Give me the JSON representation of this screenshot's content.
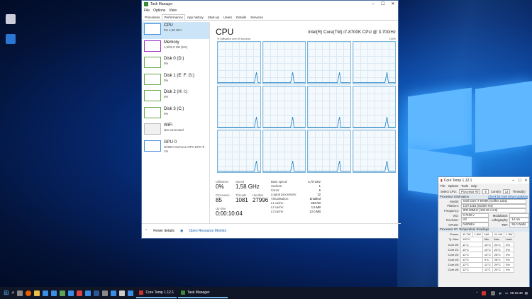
{
  "taskmanager": {
    "title": "Task Manager",
    "menu": [
      "File",
      "Options",
      "View"
    ],
    "tabs": [
      "Processes",
      "Performance",
      "App history",
      "Start-up",
      "Users",
      "Details",
      "Services"
    ],
    "resources": [
      {
        "name": "CPU",
        "sub": "0% 1,58 GHz",
        "color": "#4a90d9"
      },
      {
        "name": "Memory",
        "sub": "1,5/32,0 GB (5%)",
        "color": "#9b30c8"
      },
      {
        "name": "Disk 0 (D:)",
        "sub": "0%",
        "color": "#6aa84f"
      },
      {
        "name": "Disk 1 (E: F: G:)",
        "sub": "0%",
        "color": "#6aa84f"
      },
      {
        "name": "Disk 2 (H: I:)",
        "sub": "0%",
        "color": "#6aa84f"
      },
      {
        "name": "Disk 3 (C:)",
        "sub": "0%",
        "color": "#6aa84f"
      },
      {
        "name": "WiFi",
        "sub": "Not connected",
        "color": "#bbbbbb"
      },
      {
        "name": "GPU 0",
        "sub": "NVIDIA GeForce GTX 1070 Ti",
        "sub2": "1%",
        "color": "#4a90d9"
      }
    ],
    "cpu_title": "CPU",
    "cpu_model": "Intel(R) Core(TM) i7-8700K CPU @ 3.70GHz",
    "util_label": "% Utilisation over 60 seconds",
    "pct_max": "100%",
    "stats": {
      "utilisation_label": "Utilisation",
      "utilisation": "0%",
      "speed_label": "Speed",
      "speed": "1,58 GHz",
      "processes_label": "Processes",
      "processes": "85",
      "threads_label": "Threads",
      "threads": "1081",
      "handles_label": "Handles",
      "handles": "27996",
      "uptime_label": "Up time",
      "uptime": "0:00:10:04"
    },
    "specs": [
      {
        "k": "Base speed:",
        "v": "3,70 GHz"
      },
      {
        "k": "Sockets:",
        "v": "1"
      },
      {
        "k": "Cores:",
        "v": "6"
      },
      {
        "k": "Logical processors:",
        "v": "12"
      },
      {
        "k": "Virtualisation:",
        "v": "Enabled"
      },
      {
        "k": "L1 cache:",
        "v": "384 KB"
      },
      {
        "k": "L2 cache:",
        "v": "1,5 MB"
      },
      {
        "k": "L3 cache:",
        "v": "12,0 MB"
      }
    ],
    "fewer_details": "Fewer details",
    "open_monitor": "Open Resource Monitor"
  },
  "coretemp": {
    "title": "Core Temp 1.12.1",
    "menu": [
      "File",
      "Options",
      "Tools",
      "Help"
    ],
    "select_cpu_label": "Select CPU:",
    "processor_sel": "Processor #0",
    "cores_count": "6",
    "cores_label": "Core(s)",
    "threads_count": "12",
    "threads_label": "Thread(s)",
    "info_title": "Processor Information",
    "driver_link": "Check for Intel Driver Updates",
    "model_label": "Model:",
    "model": "Intel Core i7 8700K (Coffee Lake)",
    "platform_label": "Platform:",
    "platform": "LGA 1151 (Socket H4)",
    "frequency_label": "Frequency:",
    "frequency": "800.00MHz (100.00 x 8.0)",
    "vid_label": "VID:",
    "vid": "0.7100 v",
    "modulation_label": "Modulation:",
    "modulation": "",
    "revision_label": "Revision:",
    "revision": "U0",
    "lithography_label": "Lithography:",
    "lithography": "14 nm",
    "cpuid_label": "CPUID:",
    "cpuid": "0x906EA",
    "tdp_label": "TDP:",
    "tdp": "95.0 Watts",
    "temp_title": "Processor #0: Temperature Readings",
    "power_label": "Power:",
    "power_vals": [
      "12.7W",
      "1.6W",
      "N/A",
      "11.1W",
      "1.3W"
    ],
    "tjmax_label": "Tj. Max:",
    "tjmax": "100°C",
    "col_min": "Min.",
    "col_max": "Max.",
    "col_load": "Load",
    "cores": [
      {
        "name": "Core #0:",
        "t": "11°C",
        "min": "10°C",
        "max": "24°C",
        "load": "0%"
      },
      {
        "name": "Core #1:",
        "t": "10°C",
        "min": "10°C",
        "max": "23°C",
        "load": "0%"
      },
      {
        "name": "Core #2:",
        "t": "12°C",
        "min": "10°C",
        "max": "28°C",
        "load": "0%"
      },
      {
        "name": "Core #3:",
        "t": "12°C",
        "min": "9°C",
        "max": "28°C",
        "load": "0%"
      },
      {
        "name": "Core #4:",
        "t": "12°C",
        "min": "12°C",
        "max": "29°C",
        "load": "0%"
      },
      {
        "name": "Core #5:",
        "t": "12°C",
        "min": "11°C",
        "max": "24°C",
        "load": "0%"
      }
    ]
  },
  "taskbar": {
    "task1": "Core Temp 1.12.1",
    "task2": "Task Manager",
    "time": "06:16:48"
  }
}
